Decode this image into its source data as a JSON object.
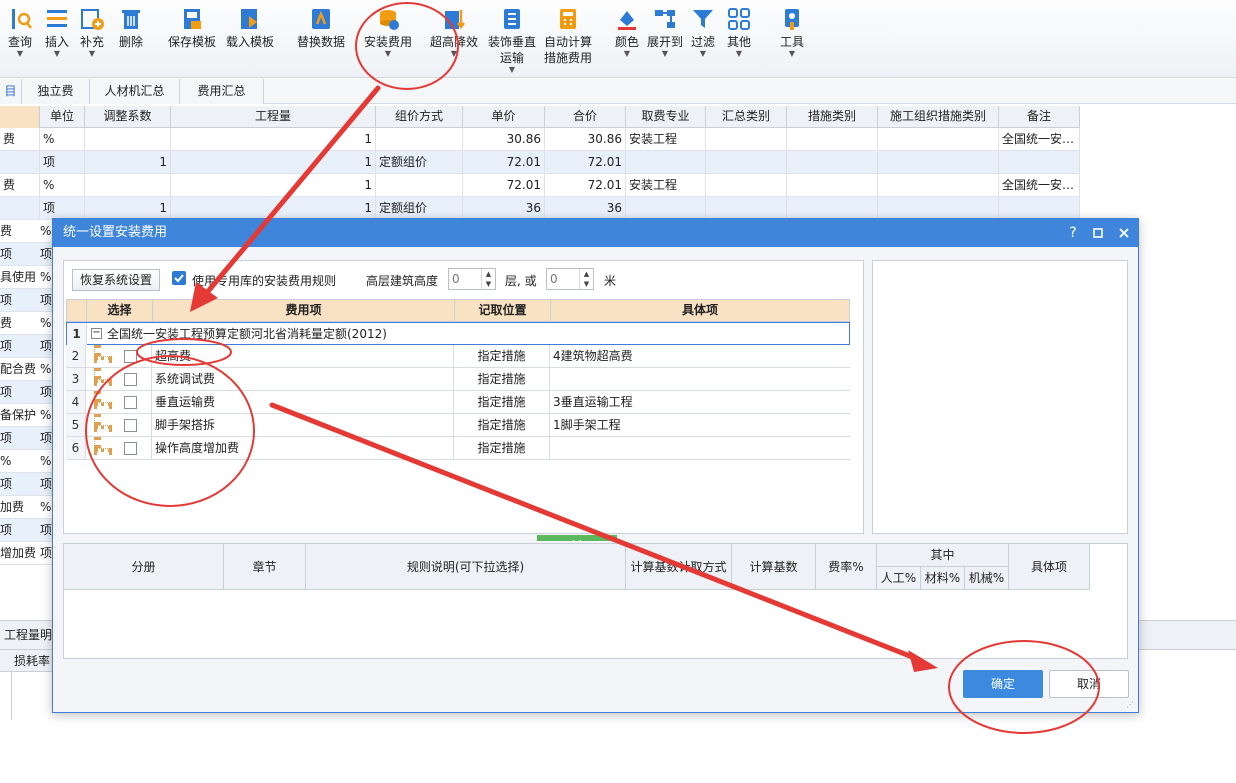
{
  "colors": {
    "accent": "#3f85dc",
    "annotation": "#e53935",
    "header_fill": "#f9e2c4"
  },
  "toolbar": {
    "items": [
      {
        "label": "查询",
        "icon": "query-icon",
        "dropdown": true
      },
      {
        "label": "插入",
        "icon": "insert-icon",
        "dropdown": true
      },
      {
        "label": "补充",
        "icon": "supplement-icon",
        "dropdown": true
      },
      {
        "label": "删除",
        "icon": "delete-icon",
        "dropdown": false
      },
      {
        "label": "保存模板",
        "icon": "save-template-icon",
        "dropdown": false
      },
      {
        "label": "载入模板",
        "icon": "load-template-icon",
        "dropdown": false
      },
      {
        "label": "替换数据",
        "icon": "replace-data-icon",
        "dropdown": false
      },
      {
        "label": "安装费用",
        "icon": "install-fee-icon",
        "dropdown": true
      },
      {
        "label": "超高降效",
        "icon": "height-reduce-icon",
        "dropdown": true
      },
      {
        "label": "装饰垂直",
        "label2": "运输",
        "icon": "vertical-transport-icon",
        "dropdown": true
      },
      {
        "label": "自动计算",
        "label2": "措施费用",
        "icon": "auto-calc-icon",
        "dropdown": false
      },
      {
        "label": "颜色",
        "icon": "color-icon",
        "dropdown": true
      },
      {
        "label": "展开到",
        "icon": "expand-icon",
        "dropdown": true
      },
      {
        "label": "过滤",
        "icon": "filter-icon",
        "dropdown": true
      },
      {
        "label": "其他",
        "icon": "other-icon",
        "dropdown": true
      },
      {
        "label": "工具",
        "icon": "tools-icon",
        "dropdown": true
      }
    ]
  },
  "tabs": [
    "目",
    "独立费",
    "人材机汇总",
    "费用汇总"
  ],
  "grid": {
    "headers": [
      "单位",
      "调整系数",
      "工程量",
      "组价方式",
      "单价",
      "合价",
      "取费专业",
      "汇总类别",
      "措施类别",
      "施工组织措施类别",
      "备注"
    ],
    "rows": [
      {
        "left": "费",
        "unit": "%",
        "coef": "",
        "qty": "1",
        "method": "",
        "price": "30.86",
        "total": "30.86",
        "major": "安装工程",
        "note": "全国统一安…"
      },
      {
        "left": "",
        "unit": "项",
        "coef": "1",
        "qty": "1",
        "method": "定额组价",
        "price": "72.01",
        "total": "72.01",
        "major": "",
        "note": ""
      },
      {
        "left": "费",
        "unit": "%",
        "coef": "",
        "qty": "1",
        "method": "",
        "price": "72.01",
        "total": "72.01",
        "major": "安装工程",
        "note": "全国统一安…"
      },
      {
        "left": "",
        "unit": "项",
        "coef": "1",
        "qty": "1",
        "method": "定额组价",
        "price": "36",
        "total": "36",
        "major": "",
        "note": ""
      }
    ],
    "left_labels": [
      "费",
      "项",
      "具使用",
      "项",
      "费",
      "项",
      "配合费",
      "项",
      "备保护",
      "项",
      "%",
      "项",
      "加费",
      "项",
      "增加费"
    ],
    "left_units": [
      "%",
      "项",
      "%",
      "项",
      "%",
      "项",
      "%",
      "项",
      "%",
      "项",
      "%",
      "项",
      "%",
      "项",
      "项"
    ],
    "bottom_tab": "工程量明细",
    "bottom_col": "损耗率"
  },
  "dialog": {
    "title": "统一设置安装费用",
    "help": "?",
    "restore_label": "恢复系统设置",
    "use_rule_label": "使用专用库的安装费用规则",
    "height_label": "高层建筑高度",
    "floor_value": "0",
    "floor_unit": "层, 或",
    "meter_value": "0",
    "meter_unit": "米",
    "fee_table": {
      "headers": [
        "选择",
        "费用项",
        "记取位置",
        "具体项"
      ],
      "group": "全国统一安装工程预算定额河北省消耗量定额(2012)",
      "rows": [
        {
          "n": "2",
          "item": "超高费",
          "pos": "指定措施",
          "detail": "4建筑物超高费"
        },
        {
          "n": "3",
          "item": "系统调试费",
          "pos": "指定措施",
          "detail": ""
        },
        {
          "n": "4",
          "item": "垂直运输费",
          "pos": "指定措施",
          "detail": "3垂直运输工程"
        },
        {
          "n": "5",
          "item": "脚手架搭拆",
          "pos": "指定措施",
          "detail": "1脚手架工程"
        },
        {
          "n": "6",
          "item": "操作高度增加费",
          "pos": "指定措施",
          "detail": ""
        }
      ]
    },
    "lower_headers": [
      "分册",
      "章节",
      "规则说明(可下拉选择)",
      "计算基数计取方式",
      "计算基数",
      "费率%",
      "其中",
      "人工%",
      "材料%",
      "机械%",
      "具体项"
    ],
    "ok_label": "确定",
    "cancel_label": "取消"
  }
}
